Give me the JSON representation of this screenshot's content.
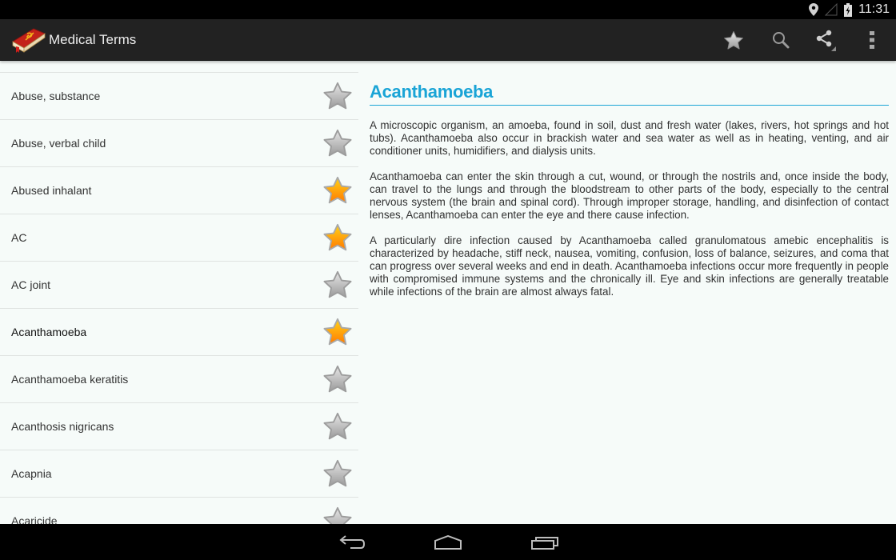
{
  "status_bar": {
    "time": "11:31",
    "icons": [
      "location-icon",
      "signal-icon",
      "battery-charging-icon"
    ]
  },
  "action_bar": {
    "app_title": "Medical Terms",
    "app_icon": "medical-book-icon",
    "actions": [
      {
        "name": "favorites",
        "icon": "star-icon"
      },
      {
        "name": "search",
        "icon": "search-icon"
      },
      {
        "name": "share",
        "icon": "share-icon"
      },
      {
        "name": "overflow-menu",
        "icon": "more-vert-icon"
      }
    ]
  },
  "term_list": {
    "items": [
      {
        "label": "Abuse, substance",
        "favorite": false,
        "selected": false
      },
      {
        "label": "Abuse, verbal child",
        "favorite": false,
        "selected": false
      },
      {
        "label": "Abused inhalant",
        "favorite": true,
        "selected": false
      },
      {
        "label": "AC",
        "favorite": true,
        "selected": false
      },
      {
        "label": "AC joint",
        "favorite": false,
        "selected": false
      },
      {
        "label": "Acanthamoeba",
        "favorite": true,
        "selected": true
      },
      {
        "label": "Acanthamoeba keratitis",
        "favorite": false,
        "selected": false
      },
      {
        "label": "Acanthosis nigricans",
        "favorite": false,
        "selected": false
      },
      {
        "label": "Acapnia",
        "favorite": false,
        "selected": false
      },
      {
        "label": "Acaricide",
        "favorite": false,
        "selected": false
      }
    ]
  },
  "detail": {
    "title": "Acanthamoeba",
    "paragraphs": [
      "A microscopic organism, an amoeba, found in soil, dust and fresh water (lakes, rivers, hot springs and hot tubs). Acanthamoeba also occur in brackish water and sea water as well as in heating, venting, and air conditioner units, humidifiers, and dialysis units.",
      "Acanthamoeba can enter the skin through a cut, wound, or through the nostrils and, once inside the body, can travel to the lungs and through the bloodstream to other parts of the body, especially to the central nervous system (the brain and spinal cord). Through improper storage, handling, and disinfection of contact lenses, Acanthamoeba can enter the eye and there cause infection.",
      "A particularly dire infection caused by Acanthamoeba called granulomatous amebic encephalitis is characterized by headache, stiff neck, nausea, vomiting, confusion, loss of balance, seizures, and coma that can progress over several weeks and end in death. Acanthamoeba infections occur more frequently in people with compromised immune systems and the chronically ill. Eye and skin infections are generally treatable while infections of the brain are almost always fatal."
    ]
  },
  "nav_bar": {
    "buttons": [
      {
        "name": "back",
        "icon": "back-icon"
      },
      {
        "name": "home",
        "icon": "home-icon"
      },
      {
        "name": "recents",
        "icon": "recent-apps-icon"
      }
    ]
  },
  "colors": {
    "accent": "#1aa4d6",
    "action_bar": "#222222",
    "background": "#f6fbf9",
    "star_on": "#ffa800",
    "star_off": "#b5b5b5"
  }
}
